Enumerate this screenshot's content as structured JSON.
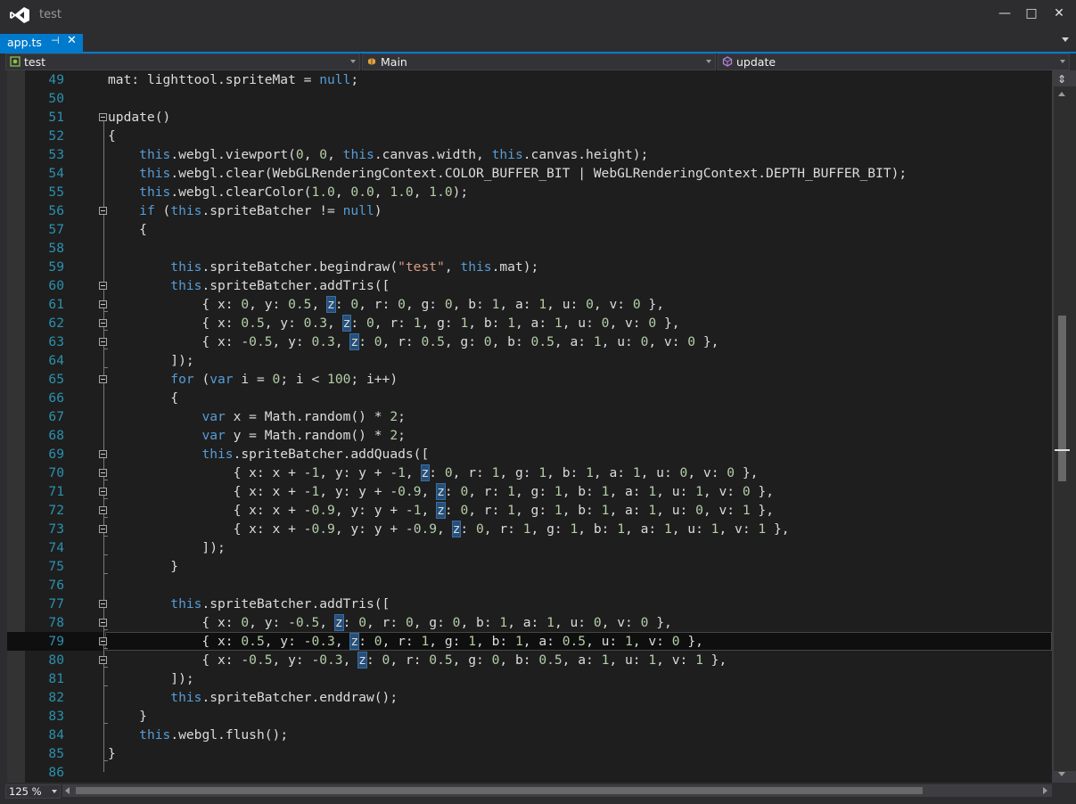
{
  "window": {
    "title": "test",
    "minimize_glyph": "—",
    "maximize_glyph": "□",
    "close_glyph": "✕"
  },
  "tab": {
    "label": "app.ts",
    "pin_glyph": "⊣",
    "close_glyph": "✕"
  },
  "navbar": {
    "project": "test",
    "type": "Main",
    "member": "update"
  },
  "editor": {
    "split_glyph": "⇕",
    "zoom": "125 %",
    "current_line": 79,
    "lines": [
      {
        "n": "49",
        "code": "mat: lighttool.spriteMat = null;"
      },
      {
        "n": "50",
        "code": ""
      },
      {
        "n": "51",
        "code": "update()"
      },
      {
        "n": "52",
        "code": "{"
      },
      {
        "n": "53",
        "code": "    this.webgl.viewport(0, 0, this.canvas.width, this.canvas.height);"
      },
      {
        "n": "54",
        "code": "    this.webgl.clear(WebGLRenderingContext.COLOR_BUFFER_BIT | WebGLRenderingContext.DEPTH_BUFFER_BIT);"
      },
      {
        "n": "55",
        "code": "    this.webgl.clearColor(1.0, 0.0, 1.0, 1.0);"
      },
      {
        "n": "56",
        "code": "    if (this.spriteBatcher != null)"
      },
      {
        "n": "57",
        "code": "    {"
      },
      {
        "n": "58",
        "code": ""
      },
      {
        "n": "59",
        "code": "        this.spriteBatcher.begindraw(\"test\", this.mat);"
      },
      {
        "n": "60",
        "code": "        this.spriteBatcher.addTris(["
      },
      {
        "n": "61",
        "code": "            { x: 0, y: 0.5, z: 0, r: 0, g: 0, b: 1, a: 1, u: 0, v: 0 },"
      },
      {
        "n": "62",
        "code": "            { x: 0.5, y: 0.3, z: 0, r: 1, g: 1, b: 1, a: 1, u: 0, v: 0 },"
      },
      {
        "n": "63",
        "code": "            { x: -0.5, y: 0.3, z: 0, r: 0.5, g: 0, b: 0.5, a: 1, u: 0, v: 0 },"
      },
      {
        "n": "64",
        "code": "        ]);"
      },
      {
        "n": "65",
        "code": "        for (var i = 0; i < 100; i++)"
      },
      {
        "n": "66",
        "code": "        {"
      },
      {
        "n": "67",
        "code": "            var x = Math.random() * 2;"
      },
      {
        "n": "68",
        "code": "            var y = Math.random() * 2;"
      },
      {
        "n": "69",
        "code": "            this.spriteBatcher.addQuads(["
      },
      {
        "n": "70",
        "code": "                { x: x + -1, y: y + -1, z: 0, r: 1, g: 1, b: 1, a: 1, u: 0, v: 0 },"
      },
      {
        "n": "71",
        "code": "                { x: x + -1, y: y + -0.9, z: 0, r: 1, g: 1, b: 1, a: 1, u: 1, v: 0 },"
      },
      {
        "n": "72",
        "code": "                { x: x + -0.9, y: y + -1, z: 0, r: 1, g: 1, b: 1, a: 1, u: 0, v: 1 },"
      },
      {
        "n": "73",
        "code": "                { x: x + -0.9, y: y + -0.9, z: 0, r: 1, g: 1, b: 1, a: 1, u: 1, v: 1 },"
      },
      {
        "n": "74",
        "code": "            ]);"
      },
      {
        "n": "75",
        "code": "        }"
      },
      {
        "n": "76",
        "code": ""
      },
      {
        "n": "77",
        "code": "        this.spriteBatcher.addTris(["
      },
      {
        "n": "78",
        "code": "            { x: 0, y: -0.5, z: 0, r: 0, g: 0, b: 1, a: 1, u: 0, v: 0 },"
      },
      {
        "n": "79",
        "code": "            { x: 0.5, y: -0.3, z: 0, r: 1, g: 1, b: 1, a: 0.5, u: 1, v: 0 },"
      },
      {
        "n": "80",
        "code": "            { x: -0.5, y: -0.3, z: 0, r: 0.5, g: 0, b: 0.5, a: 1, u: 1, v: 1 },"
      },
      {
        "n": "81",
        "code": "        ]);"
      },
      {
        "n": "82",
        "code": "        this.spriteBatcher.enddraw();"
      },
      {
        "n": "83",
        "code": "    }"
      },
      {
        "n": "84",
        "code": "    this.webgl.flush();"
      },
      {
        "n": "85",
        "code": "}"
      },
      {
        "n": "86",
        "code": ""
      }
    ]
  },
  "colors": {
    "keyword": "#569cd6",
    "number": "#b5cea8",
    "string": "#d69d85",
    "text": "#dcdcdc",
    "line_number": "#2b91af",
    "accent": "#007acc"
  }
}
